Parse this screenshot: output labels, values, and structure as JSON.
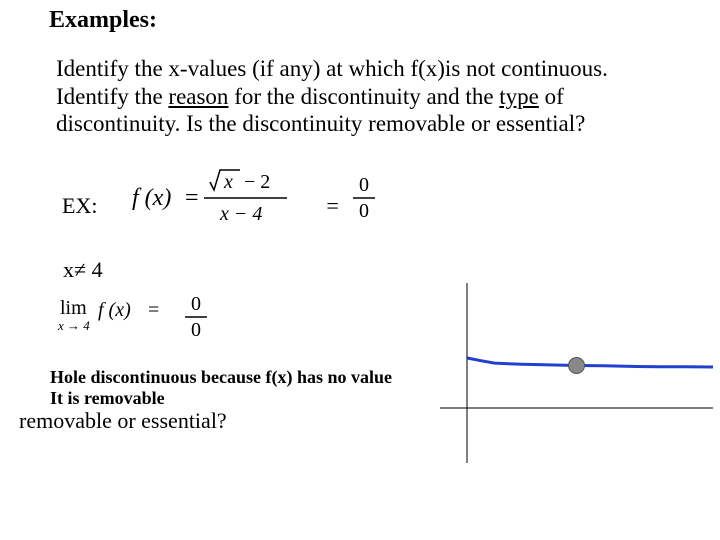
{
  "title": "Examples:",
  "prompt": {
    "line_a": "Identify the x-values (if any) at which f(x)is not continuous.",
    "line_b_pre": "Identify the ",
    "line_b_u1": "reason",
    "line_b_mid": " for the discontinuity and the ",
    "line_b_u2": "type",
    "line_b_post": " of",
    "line_c": "discontinuity. Is the discontinuity removable or essential?"
  },
  "ex_label": "EX:",
  "equals": "=",
  "xneq": "x≠ 4",
  "formula": {
    "fx": "f (x)",
    "eq": "=",
    "num_sqrt_of": "x",
    "num_minus": "− 2",
    "den": "x − 4"
  },
  "zero": {
    "top": "0",
    "bottom": "0"
  },
  "limit": {
    "lim": "lim",
    "sub": "x → 4",
    "fx": "f (x)",
    "eq": "="
  },
  "notes": {
    "n1": "Hole discontinuous because f(x) has no value",
    "n2": "It is removable",
    "n3": "removable or essential?"
  },
  "chart_data": {
    "type": "line",
    "title": "",
    "xlabel": "",
    "ylabel": "",
    "xlim": [
      -1,
      9
    ],
    "ylim": [
      -3,
      3
    ],
    "x": [
      0,
      0.5,
      1,
      2,
      3,
      4,
      5,
      6,
      7,
      8,
      9
    ],
    "y": [
      0.5,
      0.41,
      0.33,
      0.29,
      0.27,
      0.25,
      0.24,
      0.22,
      0.21,
      0.21,
      0.2
    ],
    "hole_at": {
      "x": 4,
      "y": 0.25
    }
  }
}
